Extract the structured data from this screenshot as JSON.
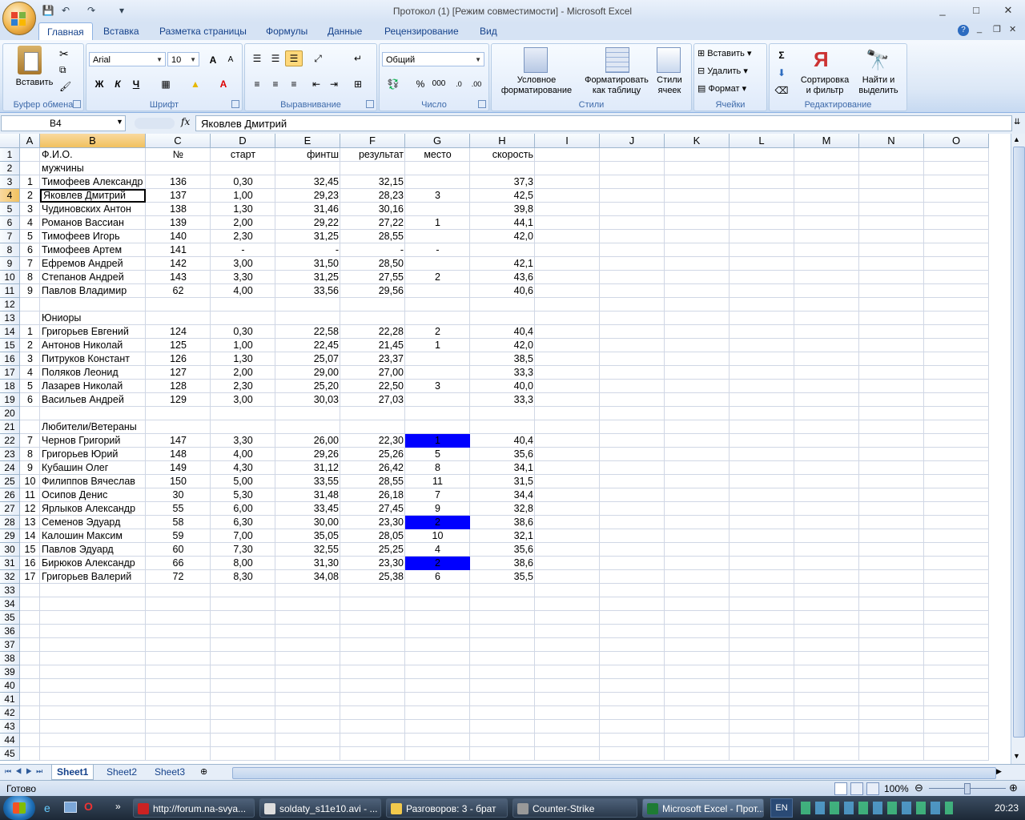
{
  "window": {
    "title": "Протокол (1)  [Режим совместимости] - Microsoft Excel",
    "controls": [
      "_",
      "□",
      "✕"
    ],
    "qat": [
      "save-icon",
      "undo-icon",
      "redo-icon"
    ],
    "qat_more": "▾"
  },
  "tabs": [
    "Главная",
    "Вставка",
    "Разметка страницы",
    "Формулы",
    "Данные",
    "Рецензирование",
    "Вид"
  ],
  "ribbon": {
    "clipboard": {
      "label": "Буфер обмена",
      "paste": "Вставить"
    },
    "font": {
      "label": "Шрифт",
      "font_name": "Arial",
      "font_size": "10",
      "grow": "A",
      "shrink": "A",
      "bold": "Ж",
      "italic": "К",
      "underline": "Ч"
    },
    "alignment": {
      "label": "Выравнивание"
    },
    "number": {
      "label": "Число",
      "format": "Общий",
      "percent": "%",
      "thousands": "000"
    },
    "styles": {
      "label": "Стили",
      "cond_format": [
        "Условное",
        "форматирование"
      ],
      "as_table": [
        "Форматировать",
        "как таблицу"
      ],
      "cell_styles": [
        "Стили",
        "ячеек"
      ]
    },
    "cells": {
      "label": "Ячейки",
      "insert": "Вставить",
      "delete": "Удалить",
      "format": "Формат"
    },
    "editing": {
      "label": "Редактирование",
      "sigma": "Σ",
      "sort": [
        "Сортировка",
        "и фильтр"
      ],
      "find": [
        "Найти и",
        "выделить"
      ]
    }
  },
  "formula_bar": {
    "name_box": "B4",
    "fx": "fx",
    "value": "Яковлев Дмитрий"
  },
  "columns": [
    "A",
    "B",
    "C",
    "D",
    "E",
    "F",
    "G",
    "H",
    "I",
    "J",
    "K",
    "L",
    "M",
    "N",
    "O"
  ],
  "selected_col": "B",
  "selected_row": "4",
  "rows": [
    [
      "1",
      "",
      "Ф.И.О.",
      "№",
      "старт",
      "финтш",
      "результат",
      "место",
      "скорость"
    ],
    [
      "2",
      "",
      "мужчины",
      "",
      "",
      "",
      "",
      "",
      ""
    ],
    [
      "3",
      "1",
      "Тимофеев Александр",
      "136",
      "0,30",
      "32,45",
      "32,15",
      "",
      "37,3"
    ],
    [
      "4",
      "2",
      "Яковлев Дмитрий",
      "137",
      "1,00",
      "29,23",
      "28,23",
      "3",
      "42,5"
    ],
    [
      "5",
      "3",
      "Чудиновских Антон",
      "138",
      "1,30",
      "31,46",
      "30,16",
      "",
      "39,8"
    ],
    [
      "6",
      "4",
      "Романов Вассиан",
      "139",
      "2,00",
      "29,22",
      "27,22",
      "1",
      "44,1"
    ],
    [
      "7",
      "5",
      "Тимофеев Игорь",
      "140",
      "2,30",
      "31,25",
      "28,55",
      "",
      "42,0"
    ],
    [
      "8",
      "6",
      "Тимофеев Артем",
      "141",
      "-",
      "-",
      "-",
      "-",
      ""
    ],
    [
      "9",
      "7",
      "Ефремов Андрей",
      "142",
      "3,00",
      "31,50",
      "28,50",
      "",
      "42,1"
    ],
    [
      "10",
      "8",
      "Степанов Андрей",
      "143",
      "3,30",
      "31,25",
      "27,55",
      "2",
      "43,6"
    ],
    [
      "11",
      "9",
      "Павлов Владимир",
      "62",
      "4,00",
      "33,56",
      "29,56",
      "",
      "40,6"
    ],
    [
      "12",
      "",
      "",
      "",
      "",
      "",
      "",
      "",
      ""
    ],
    [
      "13",
      "",
      "Юниоры",
      "",
      "",
      "",
      "",
      "",
      ""
    ],
    [
      "14",
      "1",
      "Григорьев Евгений",
      "124",
      "0,30",
      "22,58",
      "22,28",
      "2",
      "40,4"
    ],
    [
      "15",
      "2",
      "Антонов Николай",
      "125",
      "1,00",
      "22,45",
      "21,45",
      "1",
      "42,0"
    ],
    [
      "16",
      "3",
      "Питруков Констант",
      "126",
      "1,30",
      "25,07",
      "23,37",
      "",
      "38,5"
    ],
    [
      "17",
      "4",
      "Поляков Леонид",
      "127",
      "2,00",
      "29,00",
      "27,00",
      "",
      "33,3"
    ],
    [
      "18",
      "5",
      "Лазарев Николай",
      "128",
      "2,30",
      "25,20",
      "22,50",
      "3",
      "40,0"
    ],
    [
      "19",
      "6",
      "Васильев Андрей",
      "129",
      "3,00",
      "30,03",
      "27,03",
      "",
      "33,3"
    ],
    [
      "20",
      "",
      "",
      "",
      "",
      "",
      "",
      "",
      ""
    ],
    [
      "21",
      "",
      "Любители/Ветераны",
      "",
      "",
      "",
      "",
      "",
      ""
    ],
    [
      "22",
      "7",
      "Чернов Григорий",
      "147",
      "3,30",
      "26,00",
      "22,30",
      "1",
      "40,4"
    ],
    [
      "23",
      "8",
      "Григорьев Юрий",
      "148",
      "4,00",
      "29,26",
      "25,26",
      "5",
      "35,6"
    ],
    [
      "24",
      "9",
      "Кубашин Олег",
      "149",
      "4,30",
      "31,12",
      "26,42",
      "8",
      "34,1"
    ],
    [
      "25",
      "10",
      "Филиппов Вячеслав",
      "150",
      "5,00",
      "33,55",
      "28,55",
      "11",
      "31,5"
    ],
    [
      "26",
      "11",
      "Осипов Денис",
      "30",
      "5,30",
      "31,48",
      "26,18",
      "7",
      "34,4"
    ],
    [
      "27",
      "12",
      "Ярлыков Александр",
      "55",
      "6,00",
      "33,45",
      "27,45",
      "9",
      "32,8"
    ],
    [
      "28",
      "13",
      "Семенов Эдуард",
      "58",
      "6,30",
      "30,00",
      "23,30",
      "2",
      "38,6"
    ],
    [
      "29",
      "14",
      "Калошин Максим",
      "59",
      "7,00",
      "35,05",
      "28,05",
      "10",
      "32,1"
    ],
    [
      "30",
      "15",
      "Павлов Эдуард",
      "60",
      "7,30",
      "32,55",
      "25,25",
      "4",
      "35,6"
    ],
    [
      "31",
      "16",
      "Бирюков Александр",
      "66",
      "8,00",
      "31,30",
      "23,30",
      "2",
      "38,6"
    ],
    [
      "32",
      "17",
      "Григорьев Валерий",
      "72",
      "8,30",
      "34,08",
      "25,38",
      "6",
      "35,5"
    ],
    [
      "33",
      "",
      "",
      "",
      "",
      "",
      "",
      "",
      ""
    ],
    [
      "34",
      "",
      "",
      "",
      "",
      "",
      "",
      "",
      ""
    ],
    [
      "35",
      "",
      "",
      "",
      "",
      "",
      "",
      "",
      ""
    ],
    [
      "36",
      "",
      "",
      "",
      "",
      "",
      "",
      "",
      ""
    ],
    [
      "37",
      "",
      "",
      "",
      "",
      "",
      "",
      "",
      ""
    ],
    [
      "38",
      "",
      "",
      "",
      "",
      "",
      "",
      "",
      ""
    ],
    [
      "39",
      "",
      "",
      "",
      "",
      "",
      "",
      "",
      ""
    ],
    [
      "40",
      "",
      "",
      "",
      "",
      "",
      "",
      "",
      ""
    ],
    [
      "41",
      "",
      "",
      "",
      "",
      "",
      "",
      "",
      ""
    ],
    [
      "42",
      "",
      "",
      "",
      "",
      "",
      "",
      "",
      ""
    ],
    [
      "43",
      "",
      "",
      "",
      "",
      "",
      "",
      "",
      ""
    ],
    [
      "44",
      "",
      "",
      "",
      "",
      "",
      "",
      "",
      ""
    ],
    [
      "45",
      "",
      "",
      "",
      "",
      "",
      "",
      "",
      ""
    ]
  ],
  "highlighted_rows": [
    "22",
    "28",
    "31"
  ],
  "highlight_color": "#0000ff",
  "sheets": [
    "Sheet1",
    "Sheet2",
    "Sheet3"
  ],
  "active_sheet": "Sheet1",
  "status": {
    "ready": "Готово",
    "zoom": "100%"
  },
  "taskbar": {
    "tasks": [
      "http://forum.na-svya...",
      "soldaty_s11e10.avi - ...",
      "Разговоров: 3 - брат",
      "Counter-Strike",
      "Microsoft Excel - Прот..."
    ],
    "active_task": 4,
    "lang": "EN",
    "clock": "20:23"
  }
}
